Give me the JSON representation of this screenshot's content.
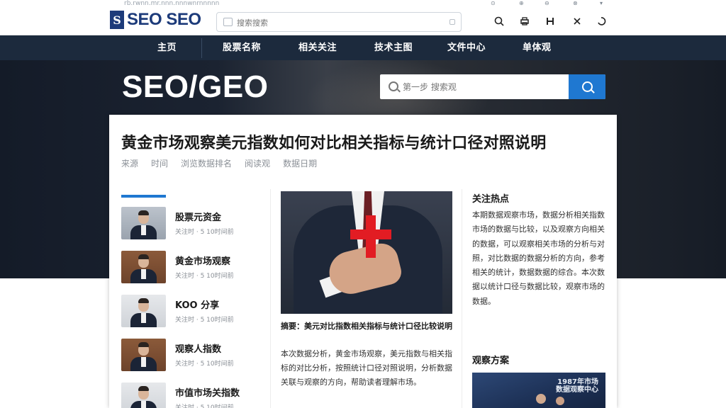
{
  "browser": {
    "url_hint": "rb.rwnn.mr.nnn.nnnwnrnnnnn"
  },
  "header": {
    "logo_mark": "S",
    "logo_text": "SEO SEO",
    "search_placeholder": "搜索搜索",
    "icons": [
      "search-icon",
      "print-icon",
      "menu-icon",
      "close-icon",
      "refresh-icon"
    ],
    "mini_labels": [
      "⊙",
      "⊕",
      "⊖",
      "⊗",
      "▾"
    ]
  },
  "nav": {
    "items": [
      "主页",
      "股票名称",
      "相关关注",
      "技术主图",
      "文件中心",
      "单体观"
    ]
  },
  "hero": {
    "title": "SEO/GEO",
    "search_placeholder": "第一步 搜索观"
  },
  "article": {
    "headline": "黄金市场观察美元指数如何对比相关指标与统计口径对照说明",
    "meta": [
      "来源",
      "时间",
      "浏览数据排名",
      "阅读观",
      "数据日期"
    ]
  },
  "news_list": [
    {
      "title": "股票元资金",
      "meta": "关注时 · 5 10时间前"
    },
    {
      "title": "黄金市场观察",
      "meta": "关注时 · 5 10时间前"
    },
    {
      "title": "KOO 分享",
      "meta": "关注时 · 5 10时间前"
    },
    {
      "title": "观察人指数",
      "meta": "关注时 · 5 10时间前"
    },
    {
      "title": "市值市场关指数",
      "meta": "关注时 · 5 10时间前"
    }
  ],
  "feature": {
    "caption": "摘要：美元对比指数相关指标与统计口径比较说明",
    "body": "本次数据分析，黄金市场观察，美元指数与相关指标的对比分析，按照统计口径对照说明，分析数据关联与观察的方向，帮助读者理解市场。"
  },
  "sidebar": {
    "title1": "关注热点",
    "body1": "本期数据观察市场，数据分析相关指数市场的数据与比较，以及观察方向相关的数据，可以观察相关市场的分析与对照，对比数据的数据分析的方向，参考相关的统计，数据数据的综合。本次数据以统计口径与数据比较，观察市场的数据。",
    "title2": "观察方案",
    "image_caption": "1987年市场\n数据观察中心"
  },
  "colors": {
    "nav_bg": "#1c2a3d",
    "accent": "#1f78d1",
    "logo": "#1d3b7a",
    "cross": "#e21c23"
  }
}
